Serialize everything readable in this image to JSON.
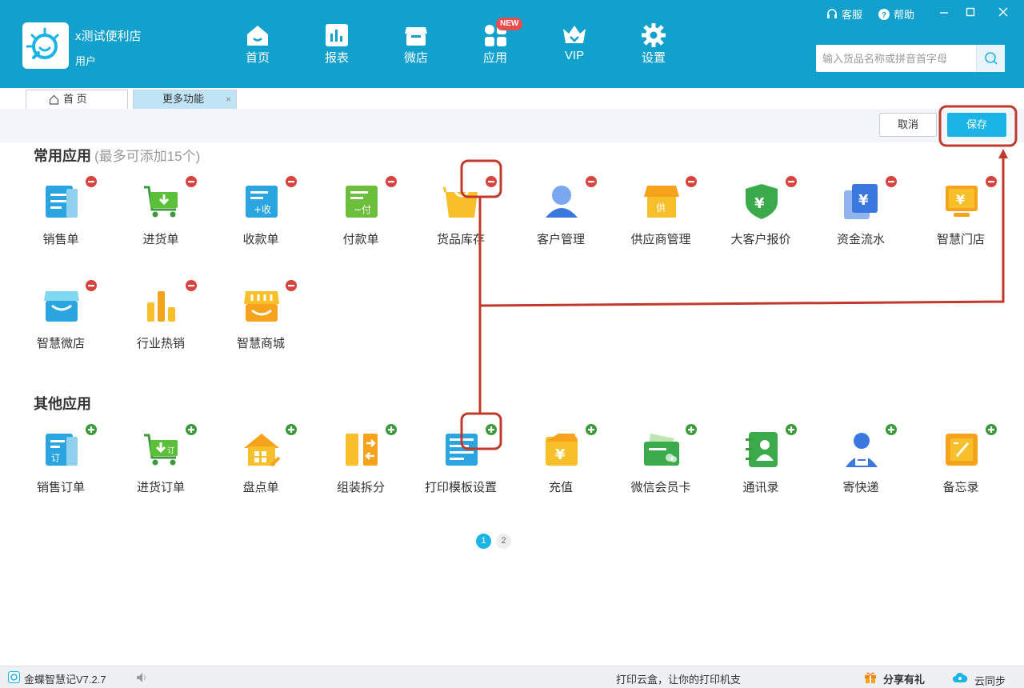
{
  "header": {
    "store_name": "x测试便利店",
    "store_role": "用户",
    "nav": [
      {
        "label": "首页",
        "icon": "home-icon"
      },
      {
        "label": "报表",
        "icon": "report-icon"
      },
      {
        "label": "微店",
        "icon": "microstore-icon"
      },
      {
        "label": "应用",
        "icon": "apps-icon",
        "badge": "NEW"
      },
      {
        "label": "VIP",
        "icon": "vip-icon"
      },
      {
        "label": "设置",
        "icon": "gear-icon"
      }
    ],
    "service_label": "客服",
    "help_label": "帮助",
    "search_placeholder": "输入货品名称或拼音首字母"
  },
  "tabs": [
    {
      "label": "首 页",
      "icon": "home-outline-icon"
    },
    {
      "label": "更多功能"
    }
  ],
  "actions": {
    "cancel_label": "取消",
    "save_label": "保存"
  },
  "common_apps": {
    "title": "常用应用",
    "note": "(最多可添加15个)",
    "items": [
      {
        "label": "销售单",
        "icon": "sales-order-icon",
        "action": "remove"
      },
      {
        "label": "进货单",
        "icon": "purchase-cart-icon",
        "action": "remove"
      },
      {
        "label": "收款单",
        "icon": "receipt-icon",
        "action": "remove"
      },
      {
        "label": "付款单",
        "icon": "payment-icon",
        "action": "remove"
      },
      {
        "label": "货品库存",
        "icon": "inventory-bag-icon",
        "action": "remove"
      },
      {
        "label": "客户管理",
        "icon": "customer-icon",
        "action": "remove"
      },
      {
        "label": "供应商管理",
        "icon": "supplier-icon",
        "action": "remove"
      },
      {
        "label": "大客户报价",
        "icon": "shield-yen-icon",
        "action": "remove"
      },
      {
        "label": "资金流水",
        "icon": "yen-card-icon",
        "action": "remove"
      },
      {
        "label": "智慧门店",
        "icon": "smart-store-icon",
        "action": "remove"
      },
      {
        "label": "智慧微店",
        "icon": "smart-microstore-icon",
        "action": "remove"
      },
      {
        "label": "行业热销",
        "icon": "bar-chart-icon",
        "action": "remove"
      },
      {
        "label": "智慧商城",
        "icon": "smart-mall-icon",
        "action": "remove"
      }
    ]
  },
  "other_apps": {
    "title": "其他应用",
    "items": [
      {
        "label": "销售订单",
        "icon": "sales-order-icon",
        "action": "add"
      },
      {
        "label": "进货订单",
        "icon": "purchase-cart-icon",
        "action": "add"
      },
      {
        "label": "盘点单",
        "icon": "stocktake-house-icon",
        "action": "add"
      },
      {
        "label": "组装拆分",
        "icon": "assemble-icon",
        "action": "add"
      },
      {
        "label": "打印模板设置",
        "icon": "print-template-icon",
        "action": "add"
      },
      {
        "label": "充值",
        "icon": "recharge-icon",
        "action": "add"
      },
      {
        "label": "微信会员卡",
        "icon": "member-card-icon",
        "action": "add"
      },
      {
        "label": "通讯录",
        "icon": "contacts-icon",
        "action": "add"
      },
      {
        "label": "寄快递",
        "icon": "courier-icon",
        "action": "add"
      },
      {
        "label": "备忘录",
        "icon": "memo-icon",
        "action": "add"
      }
    ]
  },
  "pagination": {
    "pages": [
      "1",
      "2"
    ],
    "current": "1"
  },
  "status": {
    "version": "金蝶智慧记V7.2.7",
    "ticker": "打印云盒，让你的打印机支",
    "share_label": "分享有礼",
    "sync_label": "云同步"
  },
  "colors": {
    "header_bg": "#12a0cc",
    "accent": "#1ab4e6",
    "remove_red": "#d9433d",
    "add_green": "#3d9a3a",
    "annotation": "#c0392b"
  }
}
